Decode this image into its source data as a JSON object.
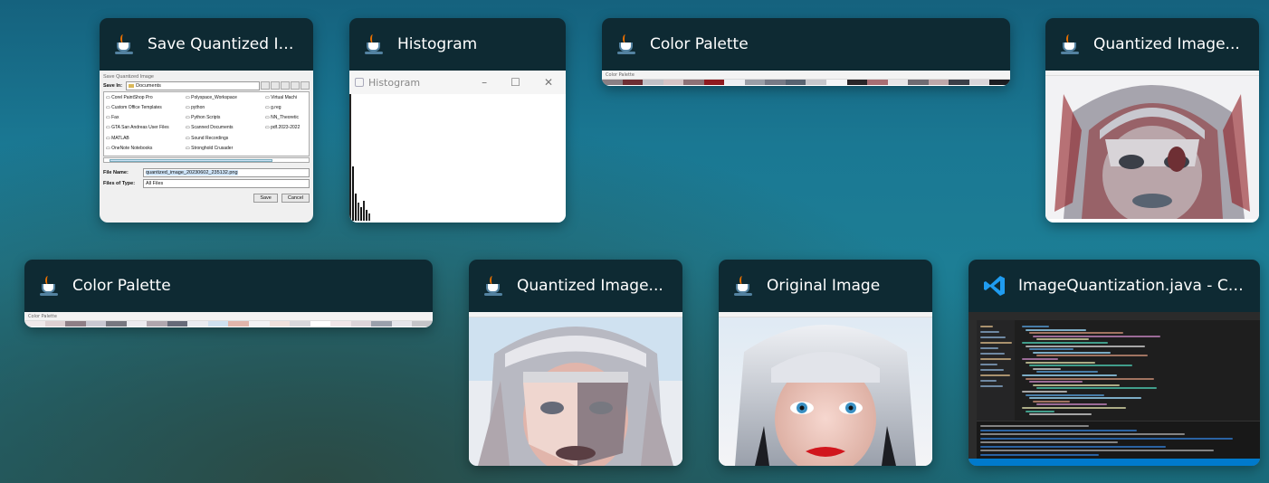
{
  "windows": [
    {
      "title": "Save Quantized Im...",
      "app": "java"
    },
    {
      "title": "Histogram",
      "app": "java"
    },
    {
      "title": "Color Palette",
      "app": "java"
    },
    {
      "title": "Quantized Image...",
      "app": "java"
    },
    {
      "title": "Color Palette",
      "app": "java"
    },
    {
      "title": "Quantized Image...",
      "app": "java"
    },
    {
      "title": "Original Image",
      "app": "java"
    },
    {
      "title": "ImageQuantization.java - Col...",
      "app": "vscode"
    }
  ],
  "save_dialog": {
    "title": "Save Quantized Image",
    "save_in_label": "Save In:",
    "save_in_value": "Documents",
    "files": [
      "Corel PaintShop Pro",
      "Polyspace_Workspace",
      "Virtual Machi",
      "Custom Office Templates",
      "python",
      "g.reg",
      "Fax",
      "Python Scripts",
      "NN_Theoretic",
      "GTA San Andreas User Files",
      "Scanned Documents",
      "pdf.2023-2022",
      "MATLAB",
      "Sound Recordings",
      "",
      "OneNote Notebooks",
      "Stronghold Crusader",
      ""
    ],
    "file_name_label": "File Name:",
    "file_name_value": "quantized_image_20230602_235132.png",
    "file_type_label": "Files of Type:",
    "file_type_value": "All Files",
    "save_button": "Save",
    "cancel_button": "Cancel"
  },
  "histogram": {
    "window_title": "Histogram"
  },
  "palette_top": {
    "window_title": "Color Palette",
    "colors": [
      "#8a7f84",
      "#6e2f34",
      "#c0c0c6",
      "#d5c3c5",
      "#8d7176",
      "#8f1a20",
      "#eceef2",
      "#9a9ea7",
      "#777a86",
      "#586371",
      "#c6c6cb",
      "#f4f4f6",
      "#2a2629",
      "#a86e73",
      "#e7e4e6",
      "#6f6b72",
      "#bda7a9",
      "#3b3f48",
      "#d8d4d8",
      "#1c1d22"
    ]
  },
  "palette_bottom": {
    "window_title": "Color Palette",
    "colors": [
      "#efe9ea",
      "#ddd0d2",
      "#8e7f86",
      "#c8c8d1",
      "#777880",
      "#ebebef",
      "#afa6ad",
      "#666a78",
      "#e9ecf1",
      "#cfe1f0",
      "#e1b5ab",
      "#f2f2f4",
      "#efe1dc",
      "#d8d8dc",
      "#ffffff",
      "#f0e6e8",
      "#dcd5d9",
      "#9aa0ab",
      "#e5e5ea",
      "#c4c4c8"
    ]
  },
  "palette_labels": {
    "small_title": "Color Palette"
  }
}
